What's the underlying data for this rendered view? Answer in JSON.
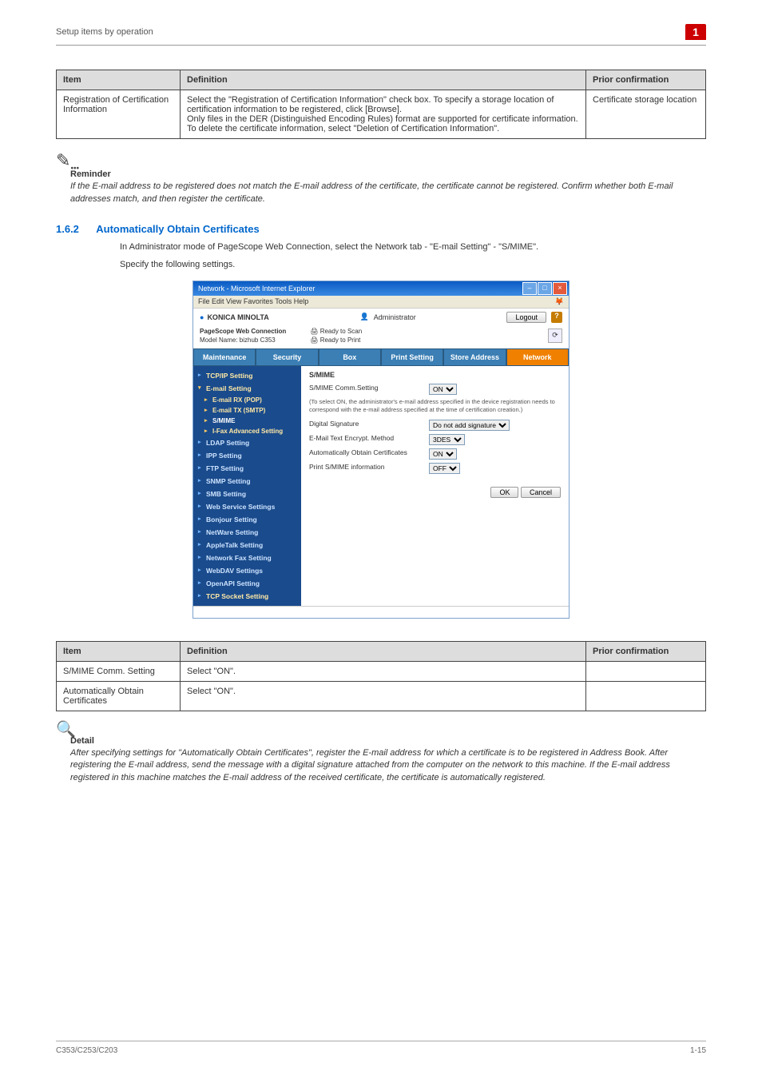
{
  "header": {
    "breadcrumb": "Setup items by operation",
    "chapter_badge": "1"
  },
  "table1": {
    "headers": [
      "Item",
      "Definition",
      "Prior confirmation"
    ],
    "rows": [
      {
        "item": "Registration of Certification Information",
        "definition": "Select the \"Registration of Certification Information\" check box. To specify a storage location of certification information to be registered, click [Browse].\nOnly files in the DER (Distinguished Encoding Rules) format are supported for certificate information.\nTo delete the certificate information, select \"Deletion of Certification Information\".",
        "prior": "Certificate storage location"
      }
    ]
  },
  "reminder": {
    "title": "Reminder",
    "body": "If the E-mail address to be registered does not match the E-mail address of the certificate, the certificate cannot be registered. Confirm whether both E-mail addresses match, and then register the certificate."
  },
  "section": {
    "num": "1.6.2",
    "title": "Automatically Obtain Certificates",
    "body1": "In Administrator mode of PageScope Web Connection, select the Network tab - \"E-mail Setting\" - \"S/MIME\".",
    "body2": "Specify the following settings."
  },
  "screenshot": {
    "window_title": "Network - Microsoft Internet Explorer",
    "menus": "File   Edit   View   Favorites   Tools   Help",
    "brand": "KONICA MINOLTA",
    "admin_label": "Administrator",
    "logout": "Logout",
    "conn_label": "PageScope Web Connection",
    "model": "Model Name: bizhub C353",
    "ready_scan": "Ready to Scan",
    "ready_print": "Ready to Print",
    "tabs": [
      "Maintenance",
      "Security",
      "Box",
      "Print Setting",
      "Store Address",
      "Network"
    ],
    "side_items": {
      "tcpip": "TCP/IP Setting",
      "email": "E-mail Setting",
      "email_rx": "E-mail RX (POP)",
      "email_tx": "E-mail TX (SMTP)",
      "smime": "S/MIME",
      "ifax": "I-Fax Advanced Setting",
      "ldap": "LDAP Setting",
      "ipp": "IPP Setting",
      "ftp": "FTP Setting",
      "snmp": "SNMP Setting",
      "smb": "SMB Setting",
      "websvc": "Web Service Settings",
      "bonjour": "Bonjour Setting",
      "netware": "NetWare Setting",
      "appletalk": "AppleTalk Setting",
      "netfax": "Network Fax Setting",
      "webdav": "WebDAV Settings",
      "openapi": "OpenAPI Setting",
      "tcpsock": "TCP Socket Setting"
    },
    "main": {
      "heading": "S/MIME",
      "rows": {
        "comm": {
          "label": "S/MIME Comm.Setting",
          "val": "ON"
        },
        "note": "(To select ON, the administrator's e-mail address specified in the device registration needs to correspond with the e-mail address specified at the time of certification creation.)",
        "sig": {
          "label": "Digital Signature",
          "val": "Do not add signature"
        },
        "enc": {
          "label": "E-Mail Text Encrypt. Method",
          "val": "3DES"
        },
        "auto": {
          "label": "Automatically Obtain Certificates",
          "val": "ON"
        },
        "print": {
          "label": "Print S/MIME information",
          "val": "OFF"
        }
      },
      "ok": "OK",
      "cancel": "Cancel"
    }
  },
  "table2": {
    "headers": [
      "Item",
      "Definition",
      "Prior confirmation"
    ],
    "rows": [
      {
        "item": "S/MIME Comm. Setting",
        "definition": "Select \"ON\".",
        "prior": ""
      },
      {
        "item": "Automatically Obtain Certificates",
        "definition": "Select \"ON\".",
        "prior": ""
      }
    ]
  },
  "detail": {
    "title": "Detail",
    "body": "After specifying settings for \"Automatically Obtain Certificates\", register the E-mail address for which a certificate is to be registered in Address Book. After registering the E-mail address, send the message with a digital signature attached from the computer on the network to this machine. If the E-mail address registered in this machine matches the E-mail address of the received certificate, the certificate is automatically registered."
  },
  "footer": {
    "left": "C353/C253/C203",
    "right": "1-15"
  }
}
